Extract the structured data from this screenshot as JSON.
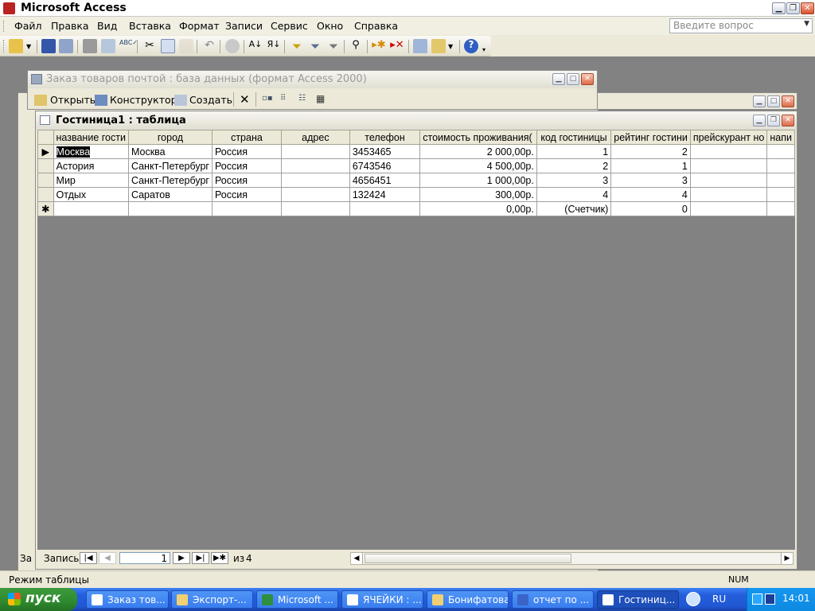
{
  "app": {
    "title": "Microsoft Access"
  },
  "menu": {
    "items": [
      {
        "key": "file",
        "text": "Файл"
      },
      {
        "key": "edit",
        "text": "Правка"
      },
      {
        "key": "view",
        "text": "Вид"
      },
      {
        "key": "insert",
        "text": "Вставка"
      },
      {
        "key": "format",
        "text": "Формат"
      },
      {
        "key": "records",
        "text": "Записи"
      },
      {
        "key": "tools",
        "text": "Сервис"
      },
      {
        "key": "window",
        "text": "Окно"
      },
      {
        "key": "help",
        "text": "Справка"
      }
    ],
    "ask_placeholder": "Введите вопрос"
  },
  "toolbar": {
    "icons": [
      "design-view-icon",
      "save-icon",
      "file-search-icon",
      "print-icon",
      "print-preview-icon",
      "spelling-icon",
      "cut-icon",
      "copy-icon",
      "paste-icon",
      "undo-icon",
      "hyperlink-icon",
      "sort-ascending-icon",
      "sort-descending-icon",
      "filter-by-selection-icon",
      "filter-by-form-icon",
      "apply-filter-icon",
      "find-icon",
      "new-record-icon",
      "delete-record-icon",
      "database-window-icon",
      "new-object-icon",
      "help-icon"
    ]
  },
  "db_window": {
    "title": "Заказ товаров почтой : база данных (формат Access 2000)",
    "open_label": "Открыть",
    "design_label": "Конструктор",
    "create_label": "Создать"
  },
  "table_window": {
    "title": "Гостиница1 : таблица",
    "columns": [
      "название гости",
      "город",
      "страна",
      "адрес",
      "телефон",
      "стоимость проживания(",
      "код гостиницы",
      "рейтинг гостини",
      "прейскурант но",
      "напи"
    ],
    "rows": [
      {
        "name": "Москва",
        "city": "Москва",
        "country": "Россия",
        "address": "",
        "phone": "3453465",
        "cost": "2 000,00р.",
        "code": "1",
        "rating": "2",
        "price_list": ""
      },
      {
        "name": "Астория",
        "city": "Санкт-Петербург",
        "country": "Россия",
        "address": "",
        "phone": "6743546",
        "cost": "4 500,00р.",
        "code": "2",
        "rating": "1",
        "price_list": ""
      },
      {
        "name": "Мир",
        "city": "Санкт-Петербург",
        "country": "Россия",
        "address": "",
        "phone": "4656451",
        "cost": "1 000,00р.",
        "code": "3",
        "rating": "3",
        "price_list": ""
      },
      {
        "name": "Отдых",
        "city": "Саратов",
        "country": "Россия",
        "address": "",
        "phone": "132424",
        "cost": "300,00р.",
        "code": "4",
        "rating": "4",
        "price_list": ""
      }
    ],
    "new_row": {
      "cost": "0,00р.",
      "code": "(Счетчик)",
      "rating": "0"
    },
    "nav": {
      "label": "Запись:",
      "current": "1",
      "of_label": "из",
      "total": "4"
    }
  },
  "behind_window": {
    "status_fragment": "За"
  },
  "status": {
    "mode": "Режим таблицы",
    "num": "NUM"
  },
  "taskbar": {
    "start_label": "пуск",
    "tasks": [
      {
        "label": "Заказ тов...",
        "icon": "access-db-icon"
      },
      {
        "label": "Экспорт-...",
        "icon": "folder-icon"
      },
      {
        "label": "Microsoft ...",
        "icon": "excel-icon"
      },
      {
        "label": "ЯЧЕЙКИ : ...",
        "icon": "table-icon"
      },
      {
        "label": "Бонифатова",
        "icon": "folder-icon"
      },
      {
        "label": "отчет по ...",
        "icon": "word-icon"
      },
      {
        "label": "Гостиниц...",
        "icon": "table-icon"
      }
    ],
    "lang": "RU",
    "clock": "14:01"
  }
}
